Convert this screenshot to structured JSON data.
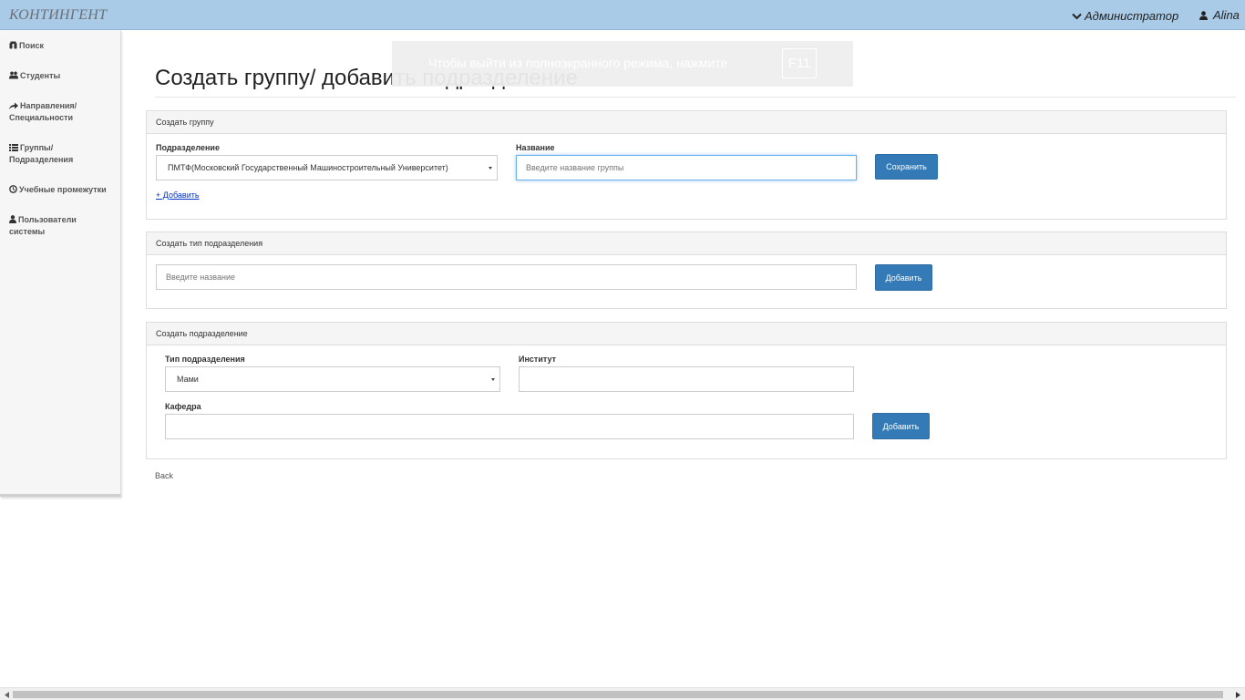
{
  "header": {
    "brand": "КОНТИНГЕНТ",
    "role_menu": "Администратор",
    "user_name": "Alina"
  },
  "sidebar": {
    "items": [
      {
        "label": "Поиск",
        "icon": "binoculars-icon"
      },
      {
        "label": "Студенты",
        "icon": "users-icon"
      },
      {
        "label_line1": "Направления/",
        "label_line2": "Специальности",
        "icon": "share-arrow-icon"
      },
      {
        "label_line1": "Группы/",
        "label_line2": "Подразделения",
        "icon": "list-icon"
      },
      {
        "label": "Учебные промежутки",
        "icon": "clock-icon"
      },
      {
        "label_line1": "Пользователи",
        "label_line2": "системы",
        "icon": "user-icon"
      }
    ]
  },
  "fullscreen_notice": {
    "text": "Чтобы выйти из полноэкранного режима, нажмите",
    "key": "F11"
  },
  "page": {
    "title": "Создать группу/ добавить подразделение",
    "back_label": "Back"
  },
  "create_group": {
    "heading": "Создать группу",
    "division_label": "Подразделение",
    "division_value": "ПМТФ(Московский Государственный Машиностроительный Университет)",
    "name_label": "Название",
    "name_placeholder": "Введите название группы",
    "save_label": "Сохранить",
    "add_link": "+ Добавить"
  },
  "create_division_type": {
    "heading": "Создать тип подразделения",
    "name_placeholder": "Введите название",
    "add_label": "Добавить"
  },
  "create_division": {
    "heading": "Создать подразделение",
    "type_label": "Тип подразделения",
    "type_value": "Мами",
    "institute_label": "Институт",
    "institute_value": "",
    "department_label": "Кафедра",
    "department_value": "",
    "add_label": "Добавить"
  },
  "colors": {
    "topbar": "#a9cbe8",
    "primary_button": "#337ab7",
    "focus_border": "#66afe9"
  }
}
